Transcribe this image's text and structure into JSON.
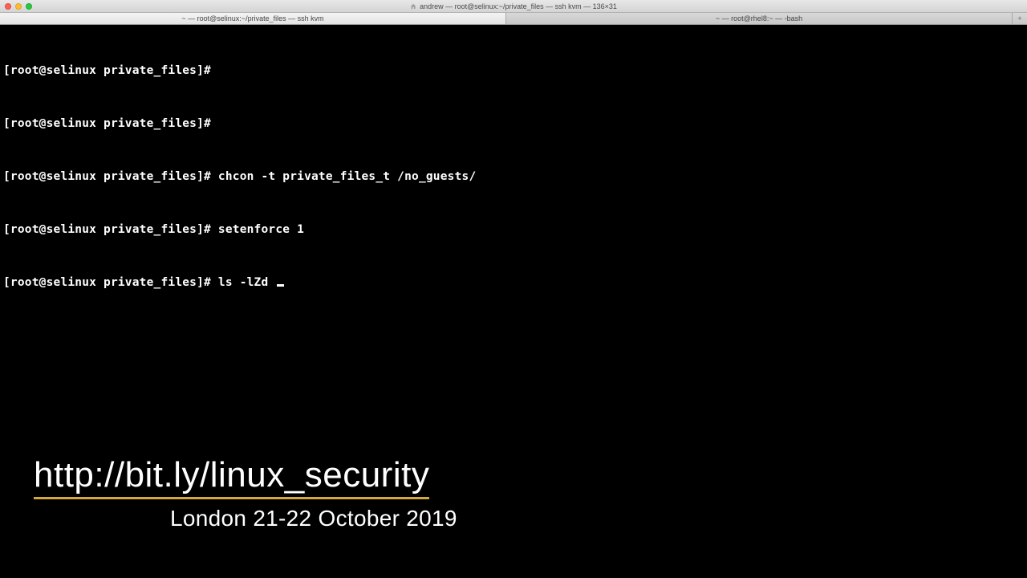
{
  "window": {
    "title": "andrew — root@selinux:~/private_files — ssh kvm — 136×31"
  },
  "tabs": [
    {
      "label": "~ — root@selinux:~/private_files — ssh kvm",
      "active": true
    },
    {
      "label": "~ — root@rhel8:~ — -bash",
      "active": false
    }
  ],
  "terminal": {
    "prompt": "[root@selinux private_files]#",
    "lines": [
      {
        "cmd": ""
      },
      {
        "cmd": ""
      },
      {
        "cmd": "chcon -t private_files_t /no_guests/"
      },
      {
        "cmd": "setenforce 1"
      },
      {
        "cmd": "ls -lZd ",
        "cursor": true
      }
    ]
  },
  "overlay": {
    "url": "http://bit.ly/linux_security",
    "sub": "London 21-22 October 2019"
  },
  "colors": {
    "accent_underline": "#d2a93a"
  }
}
